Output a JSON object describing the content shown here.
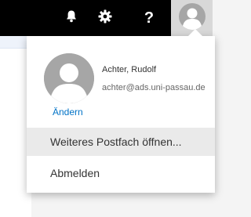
{
  "header": {
    "notifications_icon": "bell-icon",
    "settings_icon": "gear-icon",
    "help_label": "?",
    "account_icon": "avatar-icon"
  },
  "profile_menu": {
    "user_name": "Achter, Rudolf",
    "user_email": "achter@ads.uni-passau.de",
    "change_photo_label": "Ändern",
    "items": [
      {
        "label": "Weiteres Postfach öffnen..."
      },
      {
        "label": "Abmelden"
      }
    ]
  },
  "colors": {
    "topbar": "#000000",
    "link": "#0072c6",
    "hover_item": "#eaeaea",
    "avatar_gray": "#a6a6a6"
  }
}
